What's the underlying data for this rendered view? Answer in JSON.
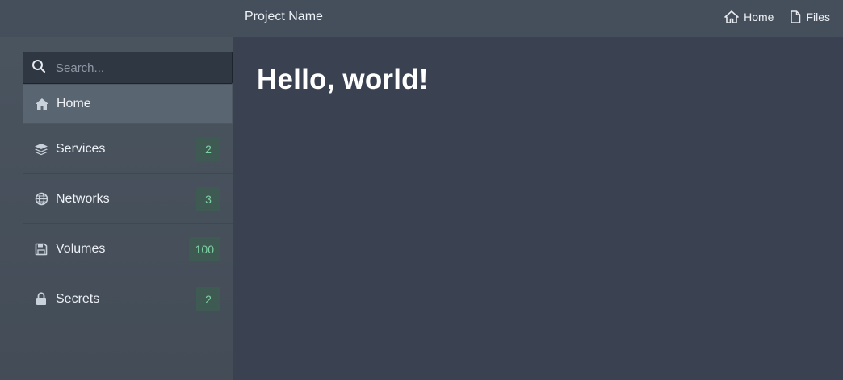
{
  "header": {
    "project_name": "Project Name",
    "nav": [
      {
        "label": "Home",
        "icon": "home-icon"
      },
      {
        "label": "Files",
        "icon": "file-icon"
      }
    ]
  },
  "search": {
    "placeholder": "Search...",
    "value": ""
  },
  "sidebar": {
    "items": [
      {
        "label": "Home",
        "icon": "home-icon",
        "active": true
      },
      {
        "label": "Services",
        "icon": "layers-icon",
        "badge": "2"
      },
      {
        "label": "Networks",
        "icon": "globe-icon",
        "badge": "3"
      },
      {
        "label": "Volumes",
        "icon": "save-icon",
        "badge": "100"
      },
      {
        "label": "Secrets",
        "icon": "lock-icon",
        "badge": "2"
      }
    ]
  },
  "main": {
    "heading": "Hello, world!"
  },
  "colors": {
    "background": "#454f5b",
    "main_panel": "#3a4252",
    "active_item": "#5a6572",
    "badge_bg": "#3e5a52",
    "badge_text": "#7ed1a5"
  }
}
